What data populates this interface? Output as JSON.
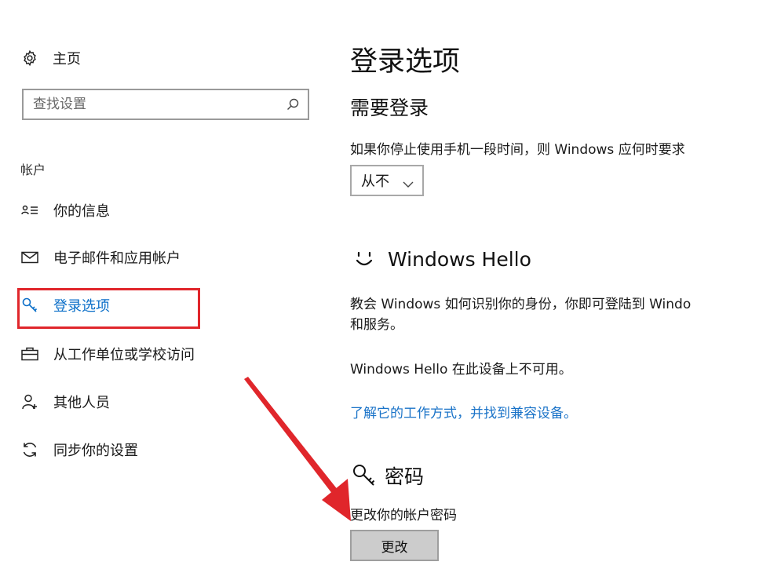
{
  "sidebar": {
    "home_label": "主页",
    "search_placeholder": "查找设置",
    "section_label": "帐户",
    "items": [
      {
        "label": "你的信息",
        "icon": "person-card-icon"
      },
      {
        "label": "电子邮件和应用帐户",
        "icon": "mail-icon"
      },
      {
        "label": "登录选项",
        "icon": "key-icon",
        "active": true
      },
      {
        "label": "从工作单位或学校访问",
        "icon": "briefcase-icon"
      },
      {
        "label": "其他人员",
        "icon": "person-add-icon"
      },
      {
        "label": "同步你的设置",
        "icon": "sync-icon"
      }
    ]
  },
  "main": {
    "title": "登录选项",
    "require_signin": {
      "heading": "需要登录",
      "description": "如果你停止使用手机一段时间，则 Windows 应何时要求",
      "dropdown_value": "从不"
    },
    "windows_hello": {
      "heading": "Windows Hello",
      "description_line1": "教会 Windows 如何识别你的身份，你即可登陆到 Windo",
      "description_line2": "和服务。",
      "unavailable": "Windows Hello 在此设备上不可用。",
      "link": "了解它的工作方式，并找到兼容设备。"
    },
    "password": {
      "heading": "密码",
      "description": "更改你的帐户密码",
      "button": "更改"
    }
  },
  "colors": {
    "accent": "#0a6ec8",
    "link": "#1a73c8",
    "annotation_red": "#e0262b"
  }
}
